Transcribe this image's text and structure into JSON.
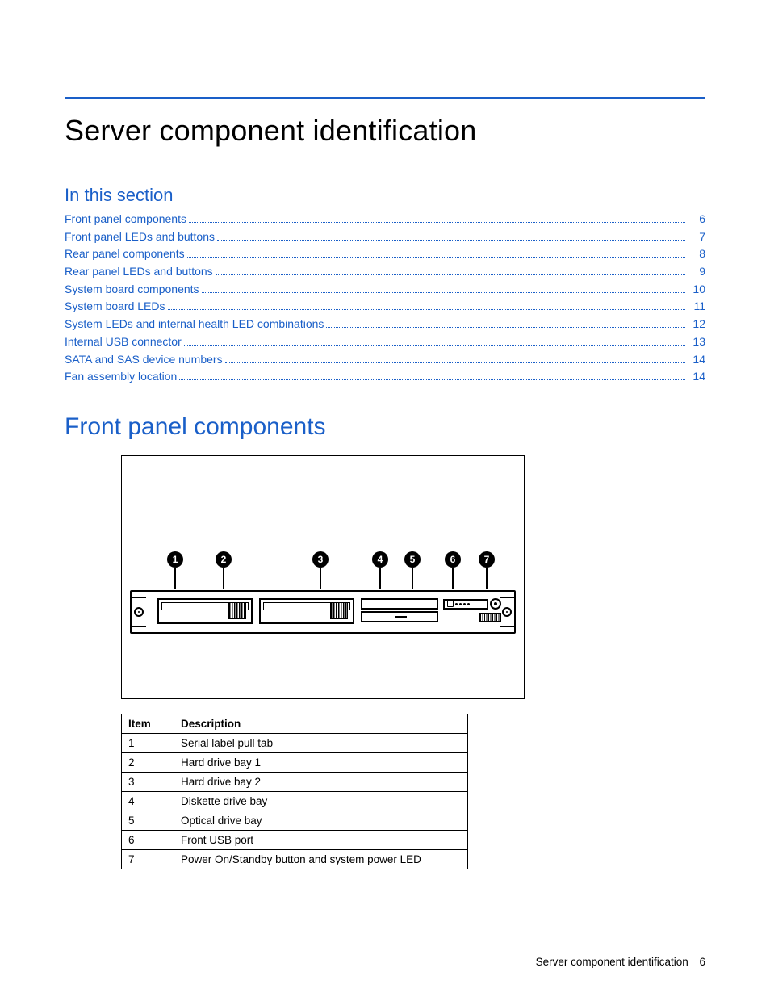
{
  "page_title": "Server component identification",
  "section_label": "In this section",
  "toc": [
    {
      "title": "Front panel components",
      "page": "6"
    },
    {
      "title": "Front panel LEDs and buttons",
      "page": "7"
    },
    {
      "title": "Rear panel components",
      "page": "8"
    },
    {
      "title": "Rear panel LEDs and buttons",
      "page": "9"
    },
    {
      "title": "System board components",
      "page": "10"
    },
    {
      "title": "System board LEDs",
      "page": "11"
    },
    {
      "title": "System LEDs and internal health LED combinations",
      "page": "12"
    },
    {
      "title": "Internal USB connector",
      "page": "13"
    },
    {
      "title": "SATA and SAS device numbers",
      "page": "14"
    },
    {
      "title": "Fan assembly location",
      "page": "14"
    }
  ],
  "subheading": "Front panel components",
  "callout_labels": [
    "1",
    "2",
    "3",
    "4",
    "5",
    "6",
    "7"
  ],
  "table": {
    "headers": {
      "item": "Item",
      "desc": "Description"
    },
    "rows": [
      {
        "item": "1",
        "desc": "Serial label pull tab"
      },
      {
        "item": "2",
        "desc": "Hard drive bay 1"
      },
      {
        "item": "3",
        "desc": "Hard drive bay 2"
      },
      {
        "item": "4",
        "desc": "Diskette drive bay"
      },
      {
        "item": "5",
        "desc": "Optical drive bay"
      },
      {
        "item": "6",
        "desc": "Front USB port"
      },
      {
        "item": "7",
        "desc": "Power On/Standby button and system power LED"
      }
    ]
  },
  "footer": {
    "text": "Server component identification",
    "page": "6"
  }
}
